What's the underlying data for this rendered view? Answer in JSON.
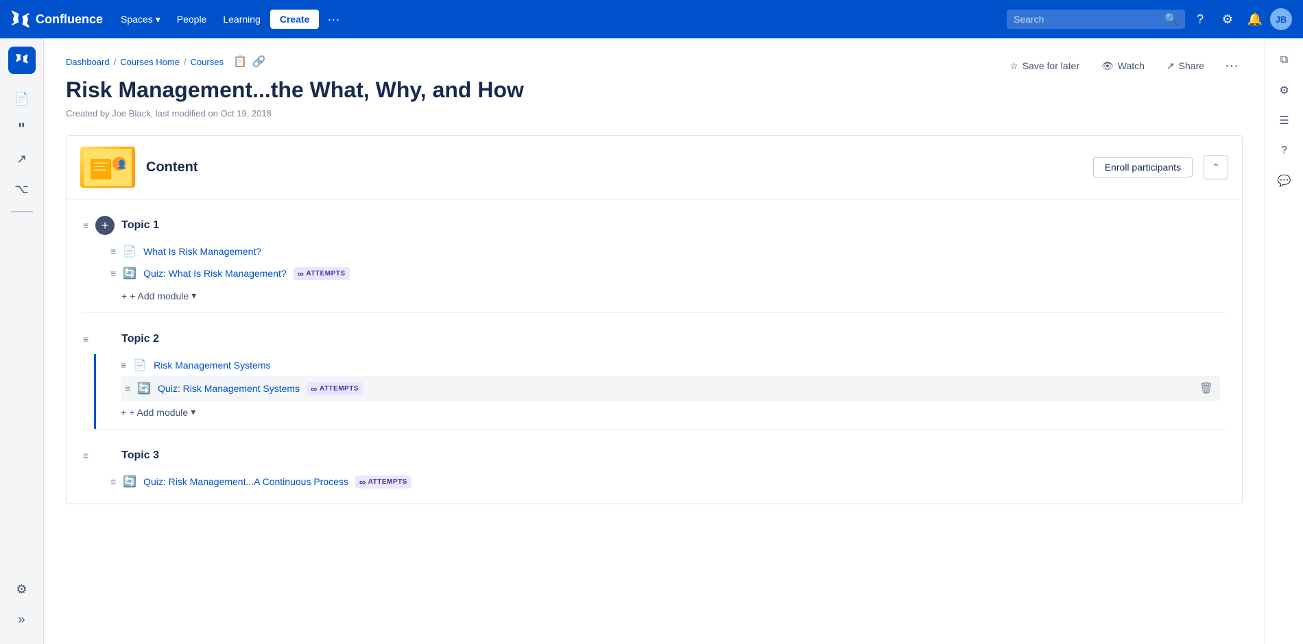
{
  "topnav": {
    "logo_text": "Confluence",
    "spaces_label": "Spaces",
    "people_label": "People",
    "learning_label": "Learning",
    "create_label": "Create",
    "more_label": "···",
    "search_placeholder": "Search"
  },
  "breadcrumb": {
    "items": [
      {
        "label": "Dashboard",
        "href": "#"
      },
      {
        "label": "Courses Home",
        "href": "#"
      },
      {
        "label": "Courses",
        "href": "#"
      }
    ]
  },
  "page_header": {
    "save_later_label": "Save for later",
    "watch_label": "Watch",
    "share_label": "Share"
  },
  "page": {
    "title": "Risk Management...the What, Why, and How",
    "meta": "Created by Joe Black, last modified on Oct 19, 2018"
  },
  "content_card": {
    "title": "Content",
    "enroll_btn": "Enroll participants"
  },
  "topics": [
    {
      "id": "topic1",
      "title": "Topic 1",
      "has_border": false,
      "modules": [
        {
          "type": "page",
          "label": "What Is Risk Management?",
          "has_attempts": false
        },
        {
          "type": "quiz",
          "label": "Quiz: What Is Risk Management?",
          "has_attempts": true,
          "attempts_text": "ATTEMPTS"
        }
      ]
    },
    {
      "id": "topic2",
      "title": "Topic 2",
      "has_border": true,
      "modules": [
        {
          "type": "page",
          "label": "Risk Management Systems",
          "has_attempts": false
        },
        {
          "type": "quiz",
          "label": "Quiz: Risk Management Systems",
          "has_attempts": true,
          "attempts_text": "ATTEMPTS",
          "show_delete": true
        }
      ]
    },
    {
      "id": "topic3",
      "title": "Topic 3",
      "has_border": false,
      "modules": [
        {
          "type": "quiz",
          "label": "Quiz: Risk Management...A Continuous Process",
          "has_attempts": true,
          "attempts_text": "ATTEMPTS"
        }
      ]
    }
  ],
  "add_module_label": "+ Add module",
  "right_panel": {
    "icons": [
      "copy",
      "settings",
      "list",
      "help",
      "comment"
    ]
  },
  "sidebar": {
    "icons": [
      "home",
      "document",
      "quote",
      "external-link",
      "hierarchy",
      "settings",
      "expand"
    ]
  }
}
